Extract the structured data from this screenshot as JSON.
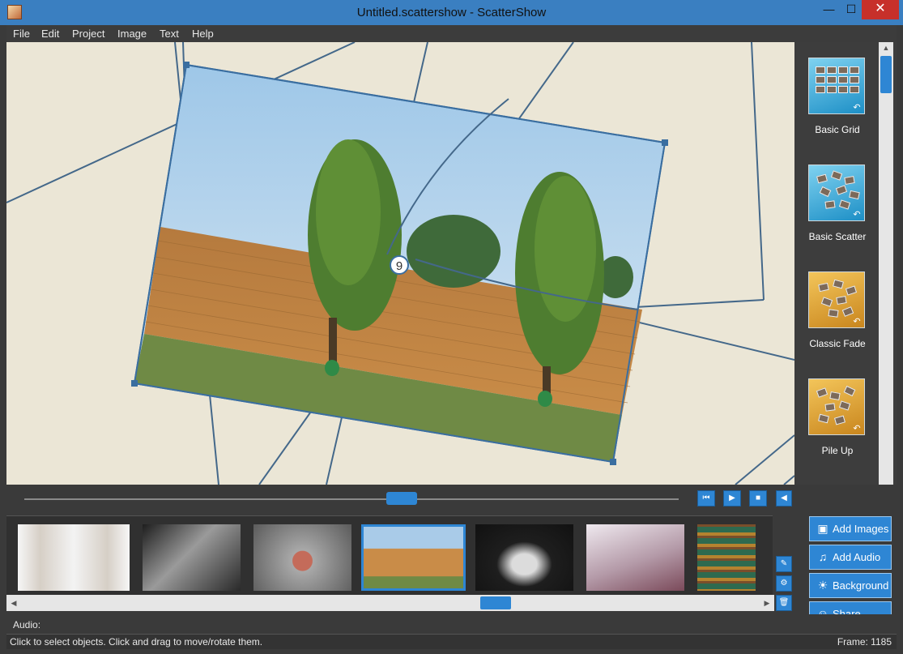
{
  "window": {
    "title": "Untitled.scattershow - ScatterShow",
    "minimize": "—",
    "maximize": "☐",
    "close": "✕"
  },
  "menu": [
    "File",
    "Edit",
    "Project",
    "Image",
    "Text",
    "Help"
  ],
  "canvas": {
    "selected_index": "9",
    "colors": {
      "background": "#ebe6d6",
      "path_line": "#44688a",
      "selection": "#3a6ea0"
    }
  },
  "themes": [
    {
      "label": "Basic Grid",
      "icon": "grid-theme-icon",
      "color": "blue"
    },
    {
      "label": "Basic Scatter",
      "icon": "scatter-theme-icon",
      "color": "blue"
    },
    {
      "label": "Classic Fade",
      "icon": "fade-theme-icon",
      "color": "gold"
    },
    {
      "label": "Pile Up",
      "icon": "pileup-theme-icon",
      "color": "gold"
    }
  ],
  "playback": {
    "position": 0.59,
    "buttons": [
      "skip-start-icon",
      "play-icon",
      "stop-icon",
      "volume-icon"
    ]
  },
  "filmstrip": {
    "photos": [
      {
        "name": "photo-twin-faces"
      },
      {
        "name": "photo-arm-wrestling"
      },
      {
        "name": "photo-splash-portrait"
      },
      {
        "name": "photo-trees-wall",
        "selected": true
      },
      {
        "name": "photo-classic-car"
      },
      {
        "name": "photo-skateboarder"
      },
      {
        "name": "photo-bookshelf"
      }
    ],
    "scroll_position": 0.63
  },
  "actions": {
    "add_images": "Add Images",
    "add_audio": "Add Audio",
    "background": "Background",
    "share": "Share"
  },
  "audio_label": "Audio:",
  "status": {
    "message": "Click to select objects. Click and drag to move/rotate them.",
    "frame": "Frame: 1185"
  }
}
